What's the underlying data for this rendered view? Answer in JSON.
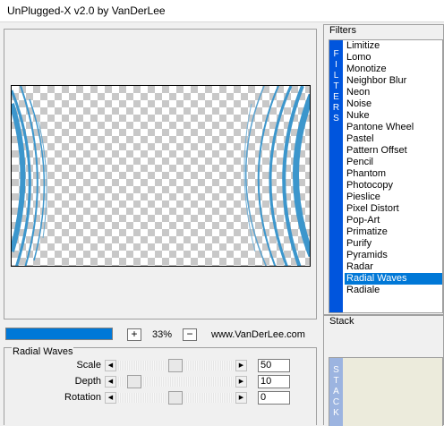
{
  "window": {
    "title": "UnPlugged-X v2.0 by VanDerLee"
  },
  "preview": {
    "progress_fraction": 1.0,
    "zoom_out_label": "+",
    "zoom_value": "33%",
    "zoom_in_label": "−",
    "website": "www.VanDerLee.com",
    "accent_color": "#3c96cc"
  },
  "params": {
    "group_label": "Radial Waves",
    "rows": [
      {
        "label": "Scale",
        "value": "50",
        "fraction": 0.5
      },
      {
        "label": "Depth",
        "value": "10",
        "fraction": 0.1
      },
      {
        "label": "Rotation",
        "value": "0",
        "fraction": 0.5
      }
    ]
  },
  "filters": {
    "group_label": "Filters",
    "tab_letters": [
      "F",
      "I",
      "L",
      "T",
      "E",
      "R",
      "S"
    ],
    "items": [
      "Limitize",
      "Lomo",
      "Monotize",
      "Neighbor Blur",
      "Neon",
      "Noise",
      "Nuke",
      "Pantone Wheel",
      "Pastel",
      "Pattern Offset",
      "Pencil",
      "Phantom",
      "Photocopy",
      "Pieslice",
      "Pixel Distort",
      "Pop-Art",
      "Primatize",
      "Purify",
      "Pyramids",
      "Radar",
      "Radial Waves",
      "Radiale"
    ],
    "selected": "Radial Waves"
  },
  "stack": {
    "group_label": "Stack",
    "tab_letters": [
      "S",
      "T",
      "A",
      "C",
      "K"
    ]
  }
}
